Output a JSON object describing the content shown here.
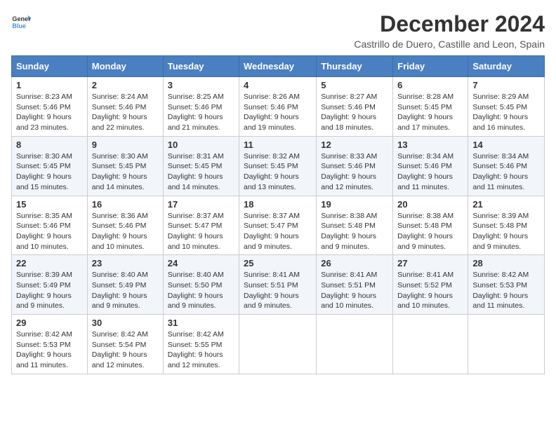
{
  "header": {
    "logo_general": "General",
    "logo_blue": "Blue",
    "month_title": "December 2024",
    "location": "Castrillo de Duero, Castille and Leon, Spain"
  },
  "calendar": {
    "headers": [
      "Sunday",
      "Monday",
      "Tuesday",
      "Wednesday",
      "Thursday",
      "Friday",
      "Saturday"
    ],
    "rows": [
      [
        {
          "day": "1",
          "info": "Sunrise: 8:23 AM\nSunset: 5:46 PM\nDaylight: 9 hours\nand 23 minutes."
        },
        {
          "day": "2",
          "info": "Sunrise: 8:24 AM\nSunset: 5:46 PM\nDaylight: 9 hours\nand 22 minutes."
        },
        {
          "day": "3",
          "info": "Sunrise: 8:25 AM\nSunset: 5:46 PM\nDaylight: 9 hours\nand 21 minutes."
        },
        {
          "day": "4",
          "info": "Sunrise: 8:26 AM\nSunset: 5:46 PM\nDaylight: 9 hours\nand 19 minutes."
        },
        {
          "day": "5",
          "info": "Sunrise: 8:27 AM\nSunset: 5:46 PM\nDaylight: 9 hours\nand 18 minutes."
        },
        {
          "day": "6",
          "info": "Sunrise: 8:28 AM\nSunset: 5:45 PM\nDaylight: 9 hours\nand 17 minutes."
        },
        {
          "day": "7",
          "info": "Sunrise: 8:29 AM\nSunset: 5:45 PM\nDaylight: 9 hours\nand 16 minutes."
        }
      ],
      [
        {
          "day": "8",
          "info": "Sunrise: 8:30 AM\nSunset: 5:45 PM\nDaylight: 9 hours\nand 15 minutes."
        },
        {
          "day": "9",
          "info": "Sunrise: 8:30 AM\nSunset: 5:45 PM\nDaylight: 9 hours\nand 14 minutes."
        },
        {
          "day": "10",
          "info": "Sunrise: 8:31 AM\nSunset: 5:45 PM\nDaylight: 9 hours\nand 14 minutes."
        },
        {
          "day": "11",
          "info": "Sunrise: 8:32 AM\nSunset: 5:45 PM\nDaylight: 9 hours\nand 13 minutes."
        },
        {
          "day": "12",
          "info": "Sunrise: 8:33 AM\nSunset: 5:46 PM\nDaylight: 9 hours\nand 12 minutes."
        },
        {
          "day": "13",
          "info": "Sunrise: 8:34 AM\nSunset: 5:46 PM\nDaylight: 9 hours\nand 11 minutes."
        },
        {
          "day": "14",
          "info": "Sunrise: 8:34 AM\nSunset: 5:46 PM\nDaylight: 9 hours\nand 11 minutes."
        }
      ],
      [
        {
          "day": "15",
          "info": "Sunrise: 8:35 AM\nSunset: 5:46 PM\nDaylight: 9 hours\nand 10 minutes."
        },
        {
          "day": "16",
          "info": "Sunrise: 8:36 AM\nSunset: 5:46 PM\nDaylight: 9 hours\nand 10 minutes."
        },
        {
          "day": "17",
          "info": "Sunrise: 8:37 AM\nSunset: 5:47 PM\nDaylight: 9 hours\nand 10 minutes."
        },
        {
          "day": "18",
          "info": "Sunrise: 8:37 AM\nSunset: 5:47 PM\nDaylight: 9 hours\nand 9 minutes."
        },
        {
          "day": "19",
          "info": "Sunrise: 8:38 AM\nSunset: 5:48 PM\nDaylight: 9 hours\nand 9 minutes."
        },
        {
          "day": "20",
          "info": "Sunrise: 8:38 AM\nSunset: 5:48 PM\nDaylight: 9 hours\nand 9 minutes."
        },
        {
          "day": "21",
          "info": "Sunrise: 8:39 AM\nSunset: 5:48 PM\nDaylight: 9 hours\nand 9 minutes."
        }
      ],
      [
        {
          "day": "22",
          "info": "Sunrise: 8:39 AM\nSunset: 5:49 PM\nDaylight: 9 hours\nand 9 minutes."
        },
        {
          "day": "23",
          "info": "Sunrise: 8:40 AM\nSunset: 5:49 PM\nDaylight: 9 hours\nand 9 minutes."
        },
        {
          "day": "24",
          "info": "Sunrise: 8:40 AM\nSunset: 5:50 PM\nDaylight: 9 hours\nand 9 minutes."
        },
        {
          "day": "25",
          "info": "Sunrise: 8:41 AM\nSunset: 5:51 PM\nDaylight: 9 hours\nand 9 minutes."
        },
        {
          "day": "26",
          "info": "Sunrise: 8:41 AM\nSunset: 5:51 PM\nDaylight: 9 hours\nand 10 minutes."
        },
        {
          "day": "27",
          "info": "Sunrise: 8:41 AM\nSunset: 5:52 PM\nDaylight: 9 hours\nand 10 minutes."
        },
        {
          "day": "28",
          "info": "Sunrise: 8:42 AM\nSunset: 5:53 PM\nDaylight: 9 hours\nand 11 minutes."
        }
      ],
      [
        {
          "day": "29",
          "info": "Sunrise: 8:42 AM\nSunset: 5:53 PM\nDaylight: 9 hours\nand 11 minutes."
        },
        {
          "day": "30",
          "info": "Sunrise: 8:42 AM\nSunset: 5:54 PM\nDaylight: 9 hours\nand 12 minutes."
        },
        {
          "day": "31",
          "info": "Sunrise: 8:42 AM\nSunset: 5:55 PM\nDaylight: 9 hours\nand 12 minutes."
        },
        {
          "day": "",
          "info": ""
        },
        {
          "day": "",
          "info": ""
        },
        {
          "day": "",
          "info": ""
        },
        {
          "day": "",
          "info": ""
        }
      ]
    ]
  }
}
